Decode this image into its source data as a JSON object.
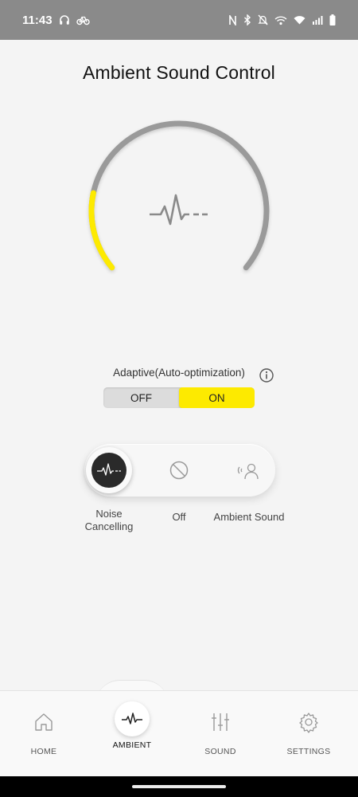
{
  "status_bar": {
    "time": "11:43",
    "left_icons": [
      "headphones-icon",
      "bicycle-icon"
    ],
    "right_icons": [
      "nfc-icon",
      "bluetooth-icon",
      "mute-icon",
      "wifi-call-icon",
      "wifi-icon",
      "signal-icon",
      "battery-icon"
    ]
  },
  "page": {
    "title": "Ambient Sound Control"
  },
  "gauge": {
    "icon": "waveform-icon",
    "level": 0.2,
    "track_color": "#9a9a9a",
    "active_color": "#fdea00"
  },
  "adaptive": {
    "label": "Adaptive(Auto-optimization)",
    "info_icon": "info-icon",
    "off_label": "OFF",
    "on_label": "ON",
    "selected": "ON"
  },
  "modes": {
    "selected": "Noise Cancelling",
    "items": [
      {
        "label": "Noise\nCancelling",
        "icon": "noise-cancelling-icon"
      },
      {
        "label": "Off",
        "icon": "off-icon"
      },
      {
        "label": "Ambient Sound",
        "icon": "ambient-sound-icon"
      }
    ]
  },
  "nav": {
    "selected": "AMBIENT",
    "items": [
      {
        "label": "HOME",
        "icon": "home-icon"
      },
      {
        "label": "AMBIENT",
        "icon": "waveform-icon"
      },
      {
        "label": "SOUND",
        "icon": "equalizer-icon"
      },
      {
        "label": "SETTINGS",
        "icon": "gear-icon"
      }
    ]
  },
  "colors": {
    "accent": "#fdea00",
    "status_bar": "#8a8a8a",
    "background": "#f4f4f4"
  }
}
